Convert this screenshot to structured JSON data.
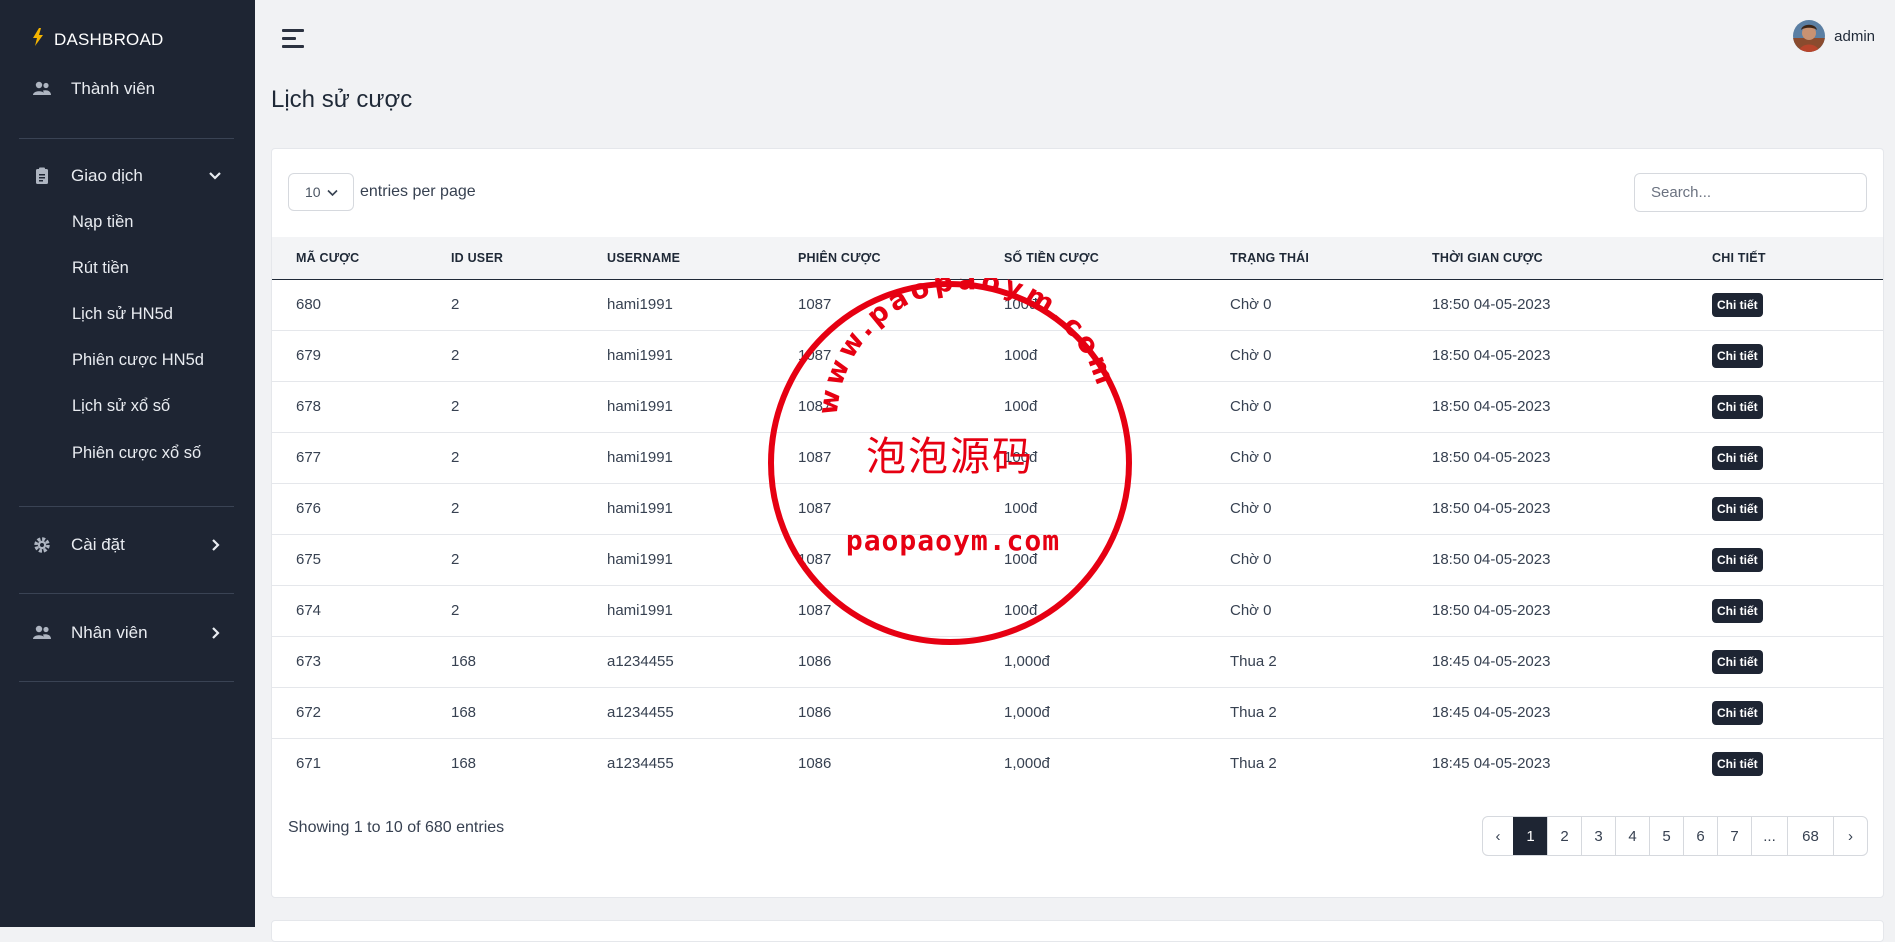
{
  "sidebar": {
    "brand": "DASHBROAD",
    "members": "Thành viên",
    "transactions": "Giao dịch",
    "sub_items": [
      "Nạp tiền",
      "Rút tiền",
      "Lịch sử HN5d",
      "Phiên cược HN5d",
      "Lịch sử xổ số",
      "Phiên cược xổ số"
    ],
    "settings": "Cài đặt",
    "staff": "Nhân viên"
  },
  "header": {
    "user_name": "admin"
  },
  "page": {
    "title": "Lịch sử cược"
  },
  "controls": {
    "per_page_value": "10",
    "per_page_label": "entries per page",
    "search_placeholder": "Search..."
  },
  "table": {
    "headers": [
      "MÃ CƯỢC",
      "ID USER",
      "USERNAME",
      "PHIÊN CƯỢC",
      "SỐ TIỀN CƯỢC",
      "TRẠNG THÁI",
      "THỜI GIAN CƯỢC",
      "CHI TIẾT"
    ],
    "rows": [
      [
        "680",
        "2",
        "hami1991",
        "1087",
        "100đ",
        "Chờ 0",
        "18:50 04-05-2023",
        "Chi tiết"
      ],
      [
        "679",
        "2",
        "hami1991",
        "1087",
        "100đ",
        "Chờ 0",
        "18:50 04-05-2023",
        "Chi tiết"
      ],
      [
        "678",
        "2",
        "hami1991",
        "1087",
        "100đ",
        "Chờ 0",
        "18:50 04-05-2023",
        "Chi tiết"
      ],
      [
        "677",
        "2",
        "hami1991",
        "1087",
        "100đ",
        "Chờ 0",
        "18:50 04-05-2023",
        "Chi tiết"
      ],
      [
        "676",
        "2",
        "hami1991",
        "1087",
        "100đ",
        "Chờ 0",
        "18:50 04-05-2023",
        "Chi tiết"
      ],
      [
        "675",
        "2",
        "hami1991",
        "1087",
        "100đ",
        "Chờ 0",
        "18:50 04-05-2023",
        "Chi tiết"
      ],
      [
        "674",
        "2",
        "hami1991",
        "1087",
        "100đ",
        "Chờ 0",
        "18:50 04-05-2023",
        "Chi tiết"
      ],
      [
        "673",
        "168",
        "a1234455",
        "1086",
        "1,000đ",
        "Thua 2",
        "18:45 04-05-2023",
        "Chi tiết"
      ],
      [
        "672",
        "168",
        "a1234455",
        "1086",
        "1,000đ",
        "Thua 2",
        "18:45 04-05-2023",
        "Chi tiết"
      ],
      [
        "671",
        "168",
        "a1234455",
        "1086",
        "1,000đ",
        "Thua 2",
        "18:45 04-05-2023",
        "Chi tiết"
      ]
    ]
  },
  "footer": {
    "info": "Showing 1 to 10 of 680 entries",
    "pages": [
      "‹",
      "1",
      "2",
      "3",
      "4",
      "5",
      "6",
      "7",
      "...",
      "68",
      "›"
    ],
    "current_page": "1"
  },
  "watermark": {
    "top_arc": "www.paopaoym.com",
    "center": "泡泡源码",
    "bottom": "paopaoym.com",
    "color": "#e60012"
  }
}
